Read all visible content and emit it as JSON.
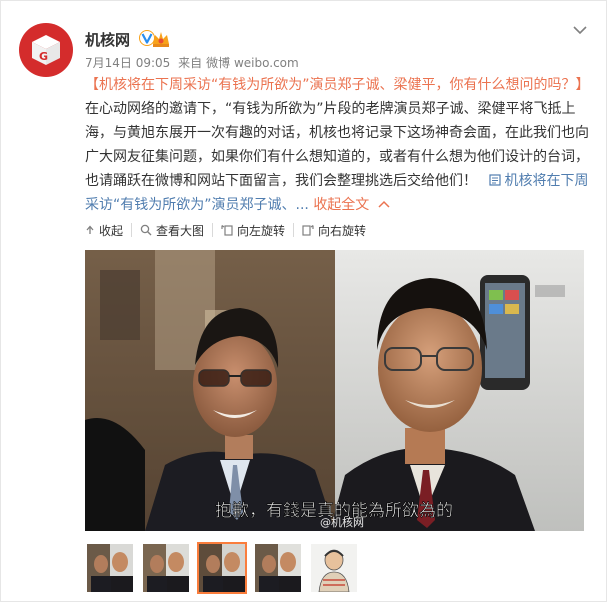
{
  "post": {
    "username": "机核网",
    "date": "7月14日 09:05",
    "source_prefix": "来自",
    "source": "微博 weibo.com",
    "text_link": "【机核将在下周采访“有钱为所欲为”演员郑子诚、梁健平，你有什么想问的吗？】",
    "text_body": "在心动网络的邀请下，“有钱为所欲为”片段的老牌演员郑子诚、梁健平将飞抵上海，与黄旭东展开一次有趣的对话，机核也将记录下这场神奇会面，在此我们也向广大网友征集问题，如果你们有什么想知道的，或者有什么想为他们设计的台词，也请踊跃在微博和网站下面留言，我们会整理挑选后交给他们！",
    "article_link": "机核将在下周采访“有钱为所欲为”演员郑子诚、...",
    "collapse_label": "收起全文",
    "colors": {
      "link": "#eb7350",
      "article": "#507daf",
      "active_thumb": "#fa7d3c"
    }
  },
  "toolbar": {
    "collapse": "收起",
    "view_large": "查看大图",
    "rotate_left": "向左旋转",
    "rotate_right": "向右旋转"
  },
  "image": {
    "subtitle": "抱歉，有錢是真的能為所欲為的",
    "watermark": "@机核网",
    "thumbnails_count": 5,
    "active_thumbnail": 3
  }
}
